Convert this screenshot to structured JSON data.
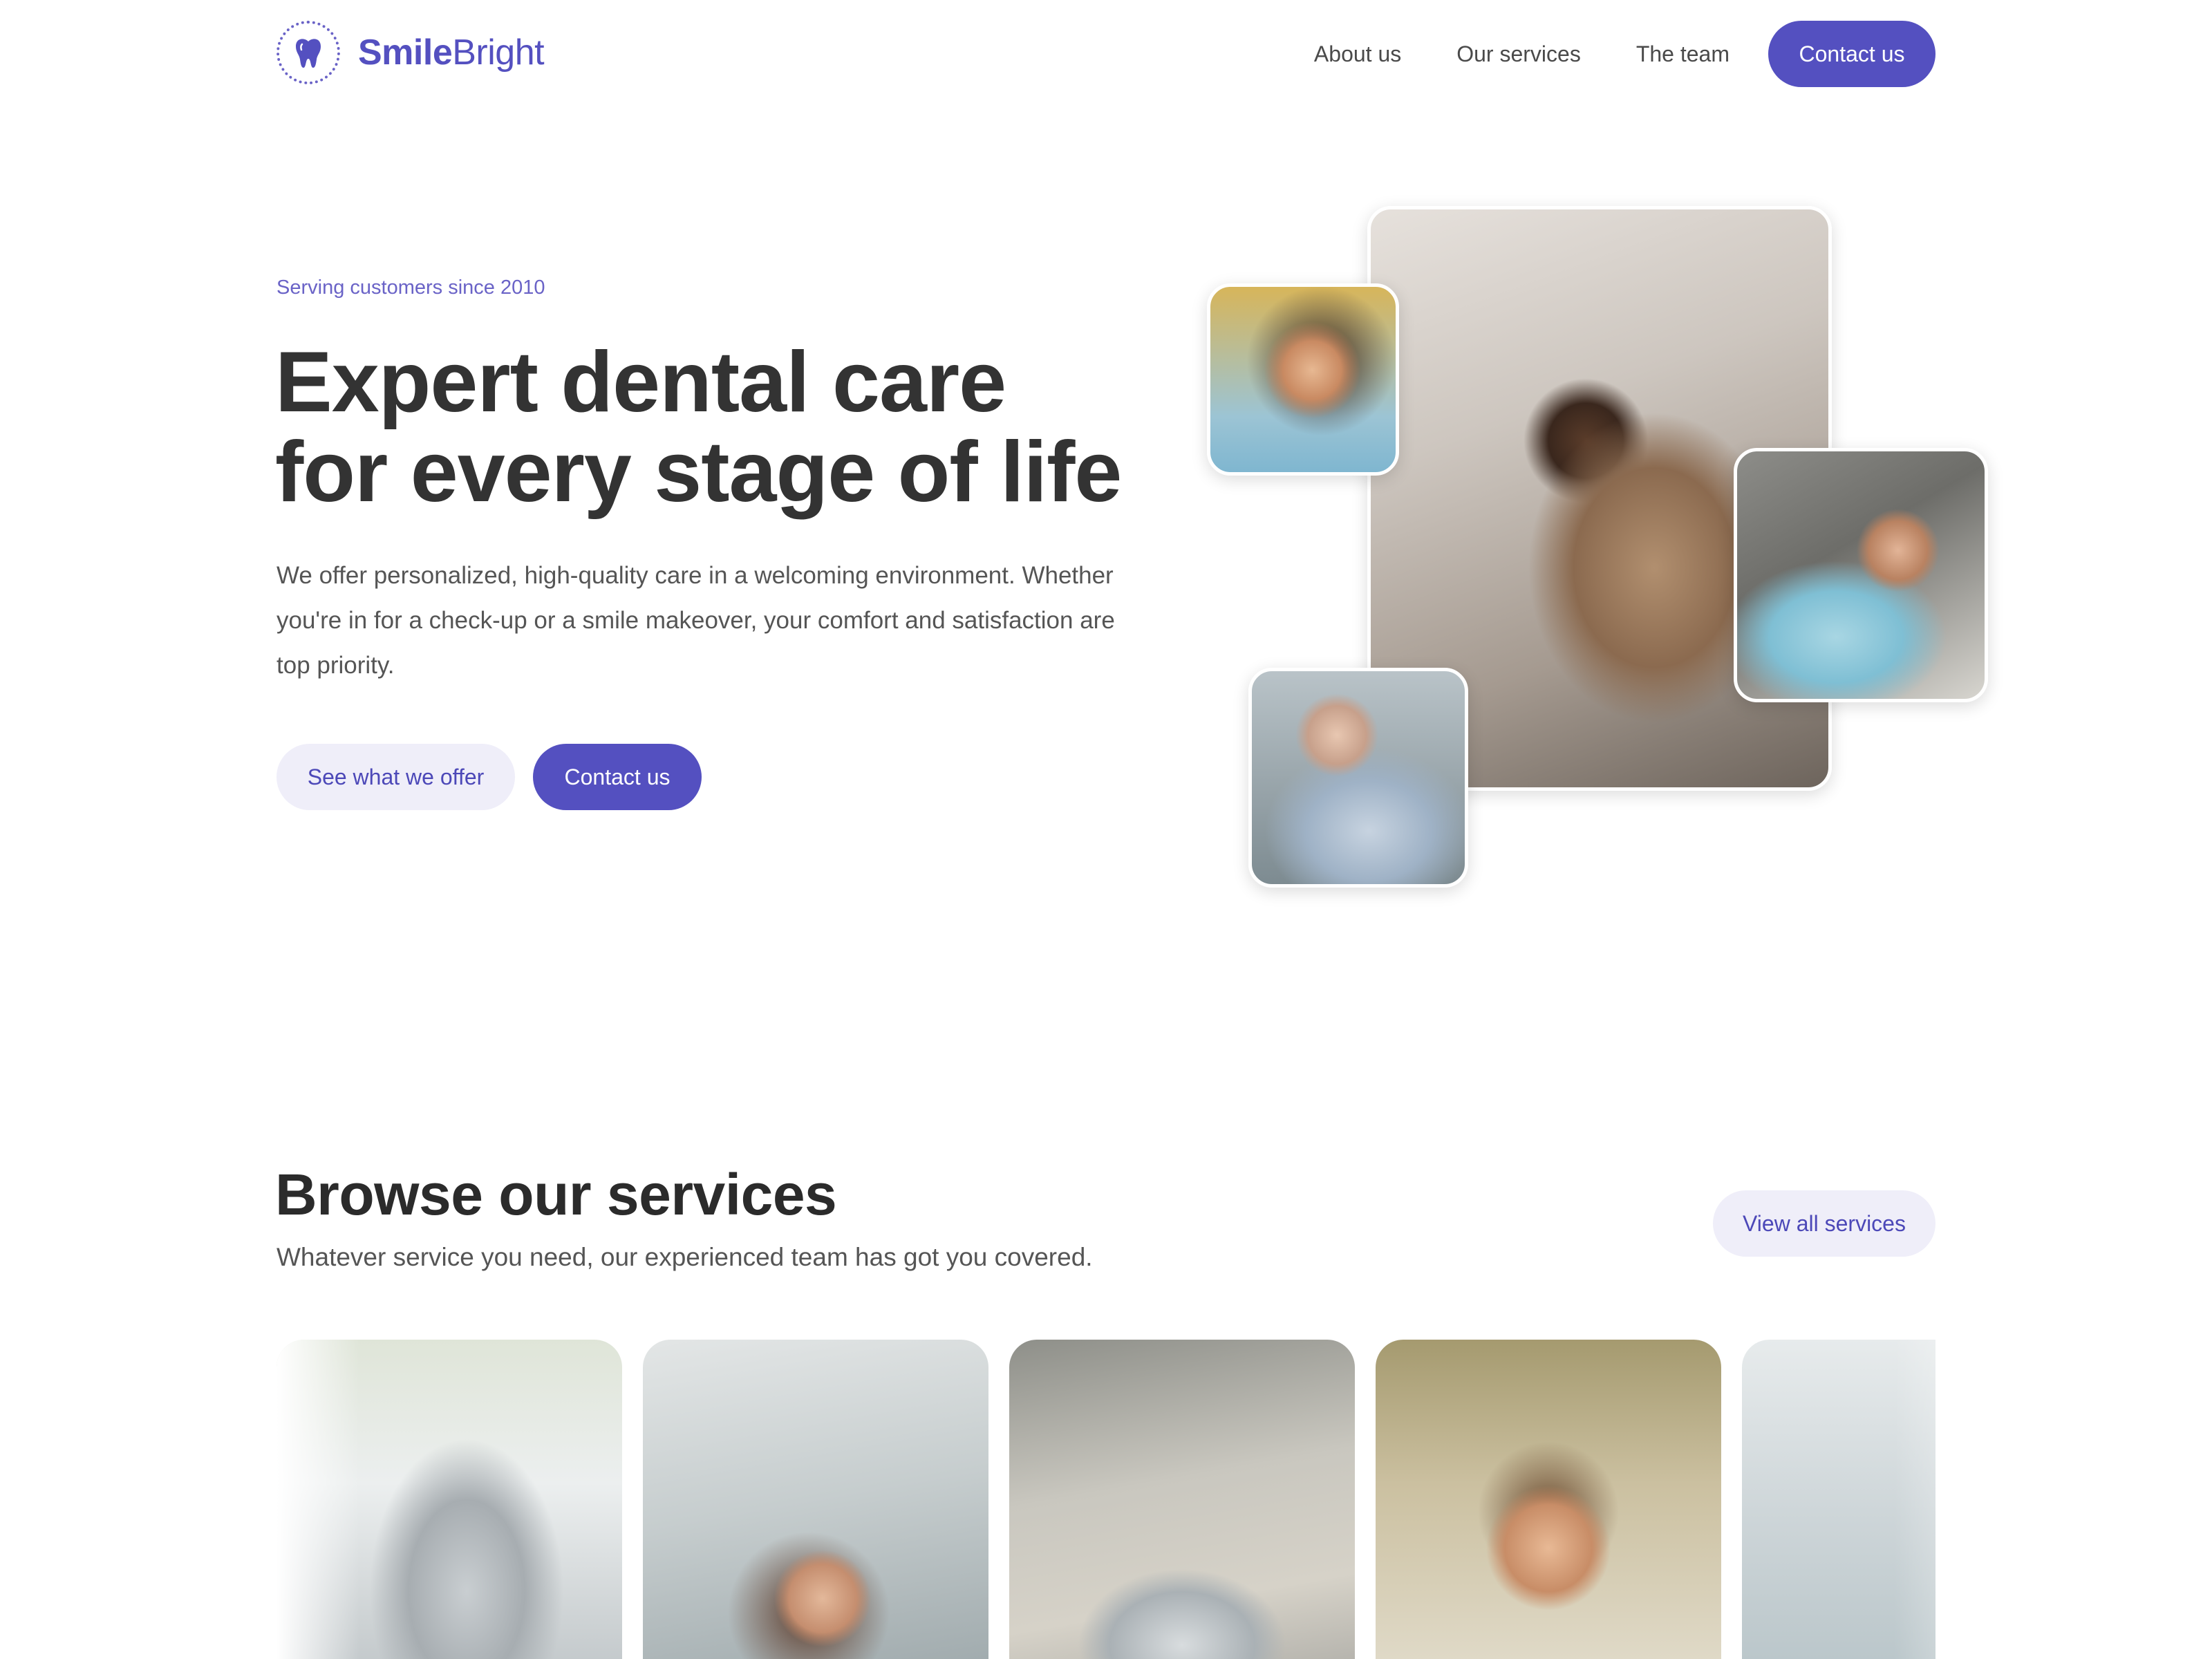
{
  "brand": {
    "name_bold": "Smile",
    "name_regular": "Bright",
    "accent_color": "#5450c0",
    "icon": "tooth-icon"
  },
  "nav": {
    "links": [
      "About us",
      "Our services",
      "The team"
    ],
    "cta": "Contact us"
  },
  "hero": {
    "eyebrow": "Serving customers since 2010",
    "title_line1": "Expert dental care",
    "title_line2": "for every stage of life",
    "description": "We offer personalized, high-quality care in a welcoming environment. Whether you're in for a check-up or a smile makeover, your comfort and satisfaction are top priority.",
    "secondary_button": "See what we offer",
    "primary_button": "Contact us"
  },
  "services": {
    "title": "Browse our services",
    "subtitle": "Whatever service you need, our experienced team has got you covered.",
    "view_all_button": "View all services"
  }
}
